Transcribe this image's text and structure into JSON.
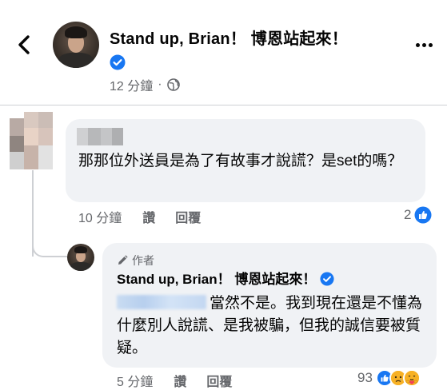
{
  "header": {
    "title": "Stand up, Brian！ 博恩站起來！",
    "time": "12 分鐘",
    "separator": "·"
  },
  "comments": [
    {
      "text": "那那位外送員是為了有故事才說謊？是set的嗎？",
      "time": "10 分鐘",
      "like_label": "讚",
      "reply_label": "回覆",
      "reaction_count": "2"
    },
    {
      "author_tag": "作者",
      "author_name": "Stand up, Brian！ 博恩站起來！",
      "text": "當然不是。我到現在還是不懂為什麼別人說謊、是我被騙，但我的誠信要被質疑。",
      "time": "5 分鐘",
      "like_label": "讚",
      "reply_label": "回覆",
      "reaction_count": "93"
    }
  ],
  "colors": {
    "accent": "#1877f2",
    "secondary_text": "#65676b",
    "bubble_bg": "#f0f2f5"
  },
  "icons": [
    "back-arrow-icon",
    "verified-badge-icon",
    "globe-icon",
    "more-icon",
    "pencil-icon",
    "like-reaction-icon",
    "sad-reaction-icon",
    "care-reaction-icon"
  ]
}
